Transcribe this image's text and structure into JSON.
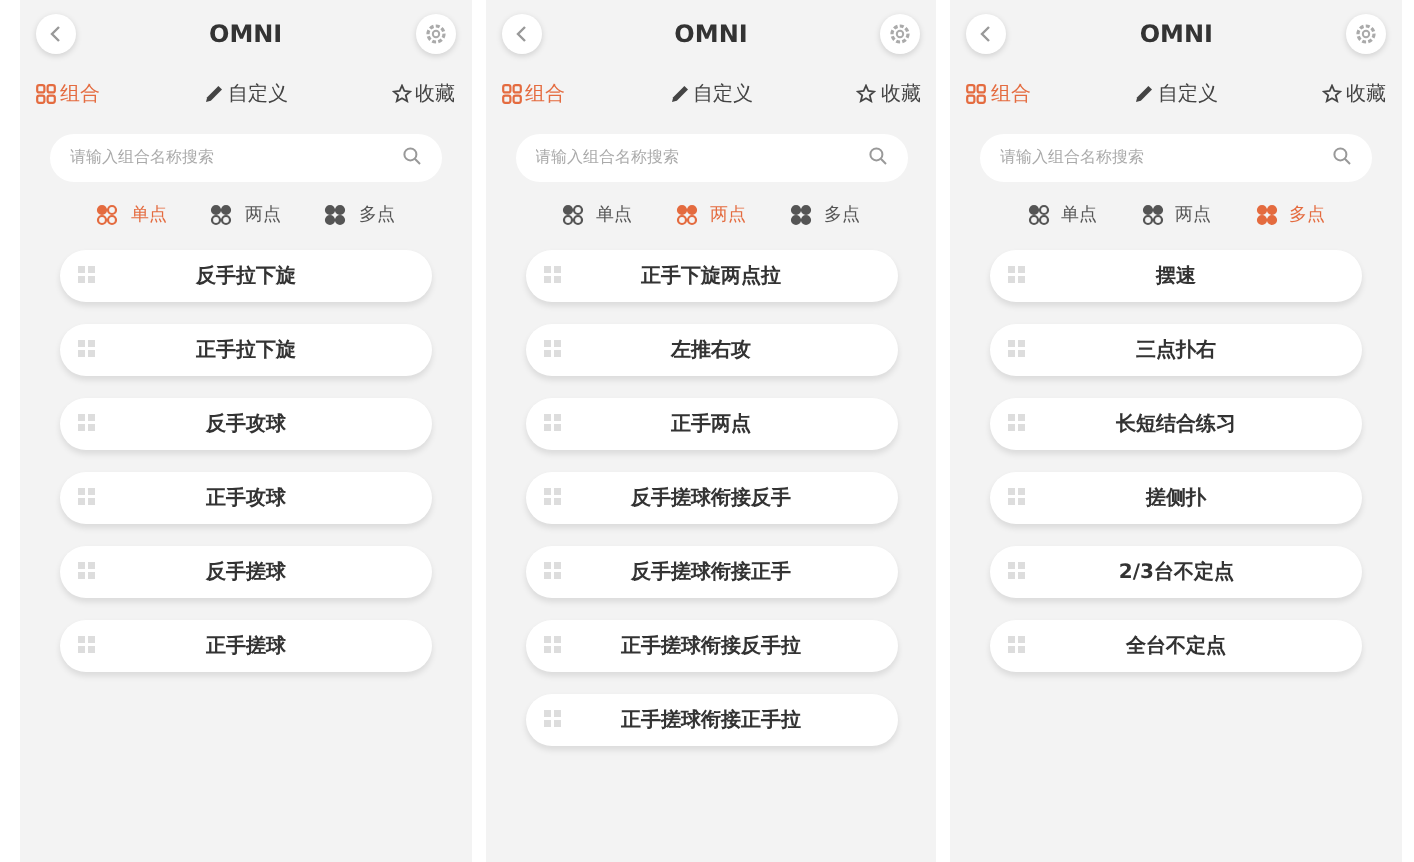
{
  "screens": [
    {
      "title": "OMNI",
      "tabs": [
        {
          "label": "组合",
          "kind": "grid",
          "selected": true
        },
        {
          "label": "自定义",
          "kind": "pencil",
          "selected": false
        },
        {
          "label": "收藏",
          "kind": "star",
          "selected": false
        }
      ],
      "search": {
        "placeholder": "请输入组合名称搜索"
      },
      "filters": [
        {
          "label": "单点",
          "kind": "single",
          "selected": true
        },
        {
          "label": "两点",
          "kind": "double",
          "selected": false
        },
        {
          "label": "多点",
          "kind": "multi",
          "selected": false
        }
      ],
      "items": [
        "反手拉下旋",
        "正手拉下旋",
        "反手攻球",
        "正手攻球",
        "反手搓球",
        "正手搓球"
      ]
    },
    {
      "title": "OMNI",
      "tabs": [
        {
          "label": "组合",
          "kind": "grid",
          "selected": true
        },
        {
          "label": "自定义",
          "kind": "pencil",
          "selected": false
        },
        {
          "label": "收藏",
          "kind": "star",
          "selected": false
        }
      ],
      "search": {
        "placeholder": "请输入组合名称搜索"
      },
      "filters": [
        {
          "label": "单点",
          "kind": "single",
          "selected": false
        },
        {
          "label": "两点",
          "kind": "double",
          "selected": true
        },
        {
          "label": "多点",
          "kind": "multi",
          "selected": false
        }
      ],
      "items": [
        "正手下旋两点拉",
        "左推右攻",
        "正手两点",
        "反手搓球衔接反手",
        "反手搓球衔接正手",
        "正手搓球衔接反手拉",
        "正手搓球衔接正手拉"
      ]
    },
    {
      "title": "OMNI",
      "tabs": [
        {
          "label": "组合",
          "kind": "grid",
          "selected": true
        },
        {
          "label": "自定义",
          "kind": "pencil",
          "selected": false
        },
        {
          "label": "收藏",
          "kind": "star",
          "selected": false
        }
      ],
      "search": {
        "placeholder": "请输入组合名称搜索"
      },
      "filters": [
        {
          "label": "单点",
          "kind": "single",
          "selected": false
        },
        {
          "label": "两点",
          "kind": "double",
          "selected": false
        },
        {
          "label": "多点",
          "kind": "multi",
          "selected": true
        }
      ],
      "items": [
        "摆速",
        "三点扑右",
        "长短结合练习",
        "搓侧扑",
        "2/3台不定点",
        "全台不定点"
      ]
    }
  ]
}
